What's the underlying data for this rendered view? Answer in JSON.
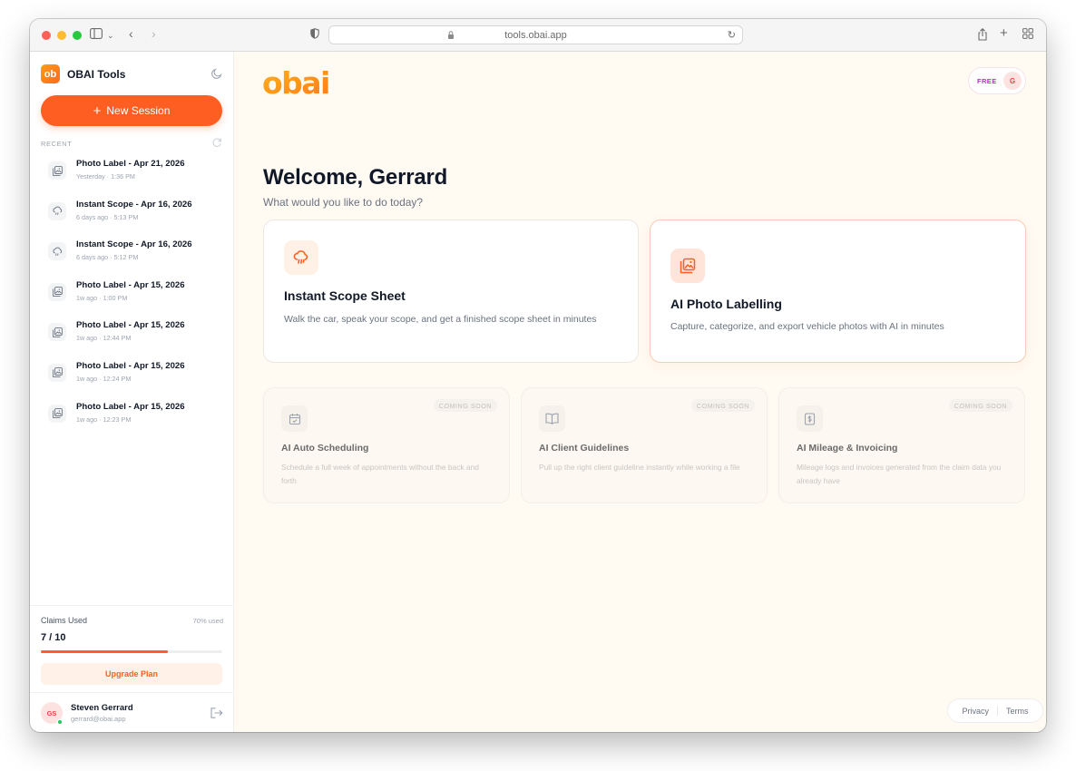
{
  "browser": {
    "url": "tools.obai.app"
  },
  "sidebar": {
    "brand": {
      "logo_text": "ob",
      "name": "OBAI Tools"
    },
    "new_session_label": "New Session",
    "recent_label": "RECENT",
    "sessions": [
      {
        "icon": "photo-label-icon",
        "title": "Photo Label - Apr 21, 2026",
        "time": "Yesterday · 1:36 PM"
      },
      {
        "icon": "instant-scope-icon",
        "title": "Instant Scope - Apr 16, 2026",
        "time": "6 days ago · 5:13 PM"
      },
      {
        "icon": "instant-scope-icon",
        "title": "Instant Scope - Apr 16, 2026",
        "time": "6 days ago · 5:12 PM"
      },
      {
        "icon": "photo-label-icon",
        "title": "Photo Label - Apr 15, 2026",
        "time": "1w ago · 1:00 PM"
      },
      {
        "icon": "photo-label-icon",
        "title": "Photo Label - Apr 15, 2026",
        "time": "1w ago · 12:44 PM"
      },
      {
        "icon": "photo-label-icon",
        "title": "Photo Label - Apr 15, 2026",
        "time": "1w ago · 12:24 PM"
      },
      {
        "icon": "photo-label-icon",
        "title": "Photo Label - Apr 15, 2026",
        "time": "1w ago · 12:23 PM"
      }
    ],
    "usage": {
      "label": "Claims Used",
      "percent_label": "70% used",
      "count": "7 / 10",
      "progress": 0.7,
      "upgrade_label": "Upgrade Plan"
    },
    "user": {
      "initials": "GS",
      "name": "Steven Gerrard",
      "email": "gerrard@obai.app",
      "status": "online"
    }
  },
  "main": {
    "logo_text": "obai",
    "plan": {
      "label": "FREE",
      "avatar_initial": "G"
    },
    "welcome": "Welcome, Gerrard",
    "subtitle": "What would you like to do today?",
    "tools": [
      {
        "icon": "cloud-rain-icon",
        "title": "Instant Scope Sheet",
        "description": "Walk the car, speak your scope, and get a finished scope sheet in minutes"
      },
      {
        "icon": "photo-gallery-icon",
        "title": "AI Photo Labelling",
        "description": "Capture, categorize, and export vehicle photos with AI in minutes"
      }
    ],
    "coming_soon": [
      {
        "icon": "calendar-icon",
        "badge": "COMING SOON",
        "title": "AI Auto Scheduling",
        "description": "Schedule a full week of appointments without the back and forth"
      },
      {
        "icon": "book-open-icon",
        "badge": "COMING SOON",
        "title": "AI Client Guidelines",
        "description": "Pull up the right client guideline instantly while working a file"
      },
      {
        "icon": "dollar-receipt-icon",
        "badge": "COMING SOON",
        "title": "AI Mileage & Invoicing",
        "description": "Mileage logs and invoices generated from the claim data you already have"
      }
    ],
    "footer": {
      "privacy": "Privacy",
      "terms": "Terms"
    }
  },
  "colors": {
    "accent": "#ff5e22",
    "main_bg": "#fffaf2",
    "plan_text": "#c026d3"
  }
}
